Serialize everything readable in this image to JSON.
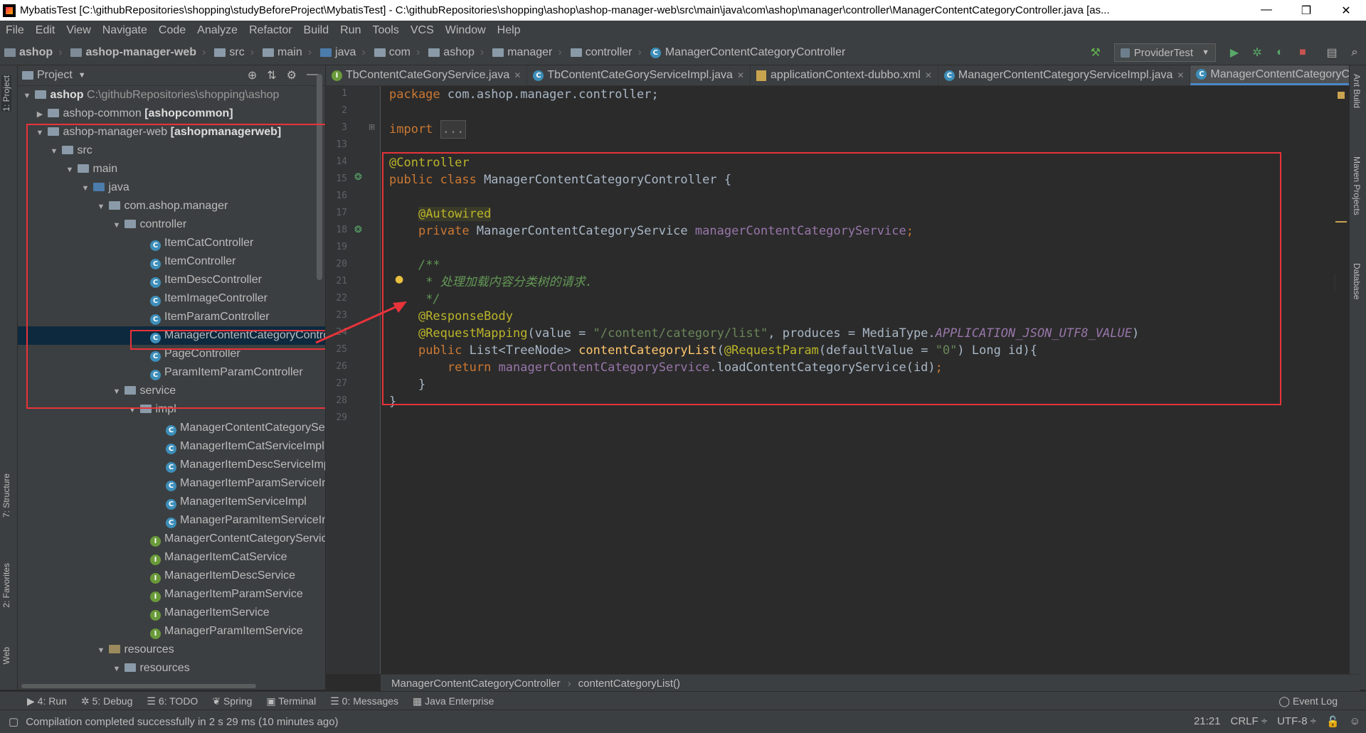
{
  "window": {
    "title": "MybatisTest [C:\\githubRepositories\\shopping\\studyBeforeProject\\MybatisTest] - C:\\githubRepositories\\shopping\\ashop\\ashop-manager-web\\src\\main\\java\\com\\ashop\\manager\\controller\\ManagerContentCategoryController.java [as..."
  },
  "menu": [
    "File",
    "Edit",
    "View",
    "Navigate",
    "Code",
    "Analyze",
    "Refactor",
    "Build",
    "Run",
    "Tools",
    "VCS",
    "Window",
    "Help"
  ],
  "navbar": {
    "crumbs": [
      "ashop",
      "ashop-manager-web",
      "src",
      "main",
      "java",
      "com",
      "ashop",
      "manager",
      "controller",
      "ManagerContentCategoryController"
    ],
    "run_config": "ProviderTest"
  },
  "stripes": {
    "left": [
      "1: Project",
      "7: Structure",
      "2: Favorites",
      "Web"
    ],
    "right": [
      "Ant Build",
      "Maven Projects",
      "Database"
    ]
  },
  "project": {
    "title": "Project",
    "rows": [
      {
        "label": "ashop",
        "extra": "C:\\githubRepositories\\shopping\\ashop"
      },
      {
        "label": "ashop-common",
        "extra": "[ashopcommon]"
      },
      {
        "label": "ashop-manager-web",
        "extra": "[ashopmanagerweb]"
      },
      {
        "label": "src"
      },
      {
        "label": "main"
      },
      {
        "label": "java"
      },
      {
        "label": "com.ashop.manager"
      },
      {
        "label": "controller"
      },
      {
        "label": "ItemCatController"
      },
      {
        "label": "ItemController"
      },
      {
        "label": "ItemDescController"
      },
      {
        "label": "ItemImageController"
      },
      {
        "label": "ItemParamController"
      },
      {
        "label": "ManagerContentCategoryController"
      },
      {
        "label": "PageController"
      },
      {
        "label": "ParamItemParamController"
      },
      {
        "label": "service"
      },
      {
        "label": "impl"
      },
      {
        "label": "ManagerContentCategoryServiceImpl"
      },
      {
        "label": "ManagerItemCatServiceImpl"
      },
      {
        "label": "ManagerItemDescServiceImpl"
      },
      {
        "label": "ManagerItemParamServiceImpl"
      },
      {
        "label": "ManagerItemServiceImpl"
      },
      {
        "label": "ManagerParamItemServiceImpl"
      },
      {
        "label": "ManagerContentCategoryService"
      },
      {
        "label": "ManagerItemCatService"
      },
      {
        "label": "ManagerItemDescService"
      },
      {
        "label": "ManagerItemParamService"
      },
      {
        "label": "ManagerItemService"
      },
      {
        "label": "ManagerParamItemService"
      },
      {
        "label": "resources"
      },
      {
        "label": "resources"
      }
    ]
  },
  "tabs": [
    {
      "label": "TbContentCateGoryService.java"
    },
    {
      "label": "TbContentCateGoryServiceImpl.java"
    },
    {
      "label": "applicationContext-dubbo.xml"
    },
    {
      "label": "ManagerContentCategoryServiceImpl.java"
    },
    {
      "label": "ManagerContentCategoryController.java"
    }
  ],
  "editor": {
    "line_numbers": [
      "1",
      "2",
      "3",
      "13",
      "14",
      "15",
      "16",
      "17",
      "18",
      "19",
      "20",
      "21",
      "22",
      "23",
      "24",
      "25",
      "26",
      "27",
      "28",
      "29"
    ],
    "code": {
      "l1_kw": "package",
      "l1_rest": " com.ashop.manager.controller;",
      "l3_kw": "import",
      "l3_fold": "...",
      "l14": "@Controller",
      "l15_kw": "public class",
      "l15_rest": " ManagerContentCategoryController {",
      "l17": "@Autowired",
      "l18_kw": "private",
      "l18_type": " ManagerContentCategoryService ",
      "l18_field": "managerContentCategoryService",
      "l18_end": ";",
      "l20": "/**",
      "l21": " * 处理加载内容分类树的请求.",
      "l22": " */",
      "l23": "@ResponseBody",
      "l24_an": "@RequestMapping",
      "l24_a": "(value = ",
      "l24_str": "\"/content/category/list\"",
      "l24_b": ", produces = MediaType.",
      "l24_const": "APPLICATION_JSON_UTF8_VALUE",
      "l24_c": ")",
      "l25_kw": "public",
      "l25_a": " List<TreeNode> ",
      "l25_m": "contentCategoryList",
      "l25_b": "(",
      "l25_an": "@RequestParam",
      "l25_c": "(defaultValue = ",
      "l25_str": "\"0\"",
      "l25_d": ") Long id){",
      "l26_kw": "return",
      "l26_sp": " ",
      "l26_field": "managerContentCategoryService",
      "l26_rest": ".loadContentCategoryService(id)",
      "l26_end": ";",
      "l27": "}",
      "l28": "}"
    },
    "breadcrumb": [
      "ManagerContentCategoryController",
      "contentCategoryList()"
    ]
  },
  "bottom_tools": [
    "4: Run",
    "5: Debug",
    "6: TODO",
    "Spring",
    "Terminal",
    "0: Messages",
    "Java Enterprise"
  ],
  "event_log": "Event Log",
  "status": {
    "message": "Compilation completed successfully in 2 s 29 ms (10 minutes ago)",
    "position": "21:21",
    "line_sep": "CRLF",
    "encoding": "UTF-8"
  },
  "colors": {
    "highlight_box": "#e8333a",
    "selection": "#0d293e",
    "accent": "#4a88c7"
  }
}
